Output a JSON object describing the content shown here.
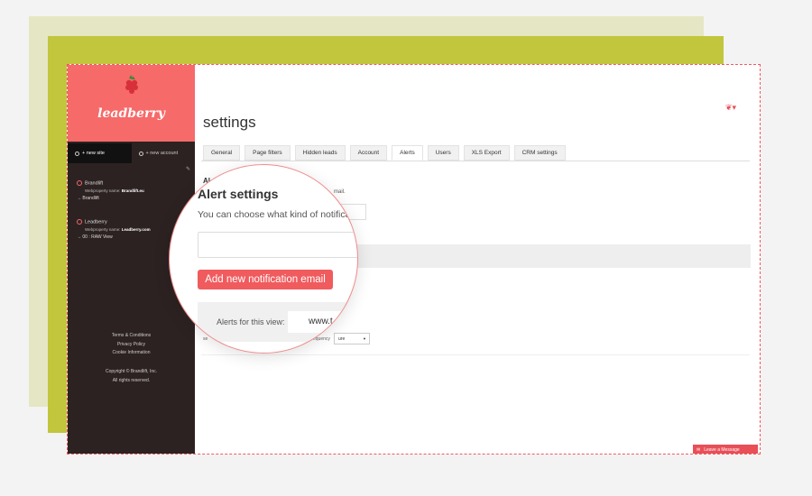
{
  "colors": {
    "accent": "#e84f57",
    "sidebar": "#2d2222",
    "brand_bg": "#f66a6a"
  },
  "brand": {
    "name": "leadberry",
    "logo_icon": "raspberry-icon"
  },
  "sidebar": {
    "tabs": [
      {
        "label": "+ new site"
      },
      {
        "label": "+ new account"
      }
    ],
    "sites": [
      {
        "name": "Brandlift",
        "property_label": "Webproperty name:",
        "property_value": "Brandlift.eu",
        "view": "Brandlift"
      },
      {
        "name": "Leadberry",
        "property_label": "Webproperty name:",
        "property_value": "Leadberry.com",
        "view": "00 : RAW View"
      }
    ],
    "footer_links": [
      "Terms & Conditions",
      "Privacy Policy",
      "Cookie Information"
    ],
    "copyright": [
      "Copyright © Brandlift, Inc.",
      "All rights reserved."
    ]
  },
  "header": {
    "title": "settings"
  },
  "tabs": [
    {
      "label": "General"
    },
    {
      "label": "Page filters"
    },
    {
      "label": "Hidden leads"
    },
    {
      "label": "Account"
    },
    {
      "label": "Alerts",
      "active": true
    },
    {
      "label": "Users"
    },
    {
      "label": "XLS Export"
    },
    {
      "label": "CRM settings"
    }
  ],
  "alerts": {
    "title_fragment": "Al",
    "sub_fragment": "mail.",
    "freq_label_fragment": "equency",
    "se_fragment": "se",
    "freq_value": "ure"
  },
  "magnifier": {
    "title": "Alert settings",
    "subtitle": "You can choose what kind of notificati",
    "add_button": "Add new notification email",
    "alerts_label": "Alerts for this view:",
    "alerts_value": "www.t"
  },
  "chat": {
    "label": "Leave a Message"
  }
}
